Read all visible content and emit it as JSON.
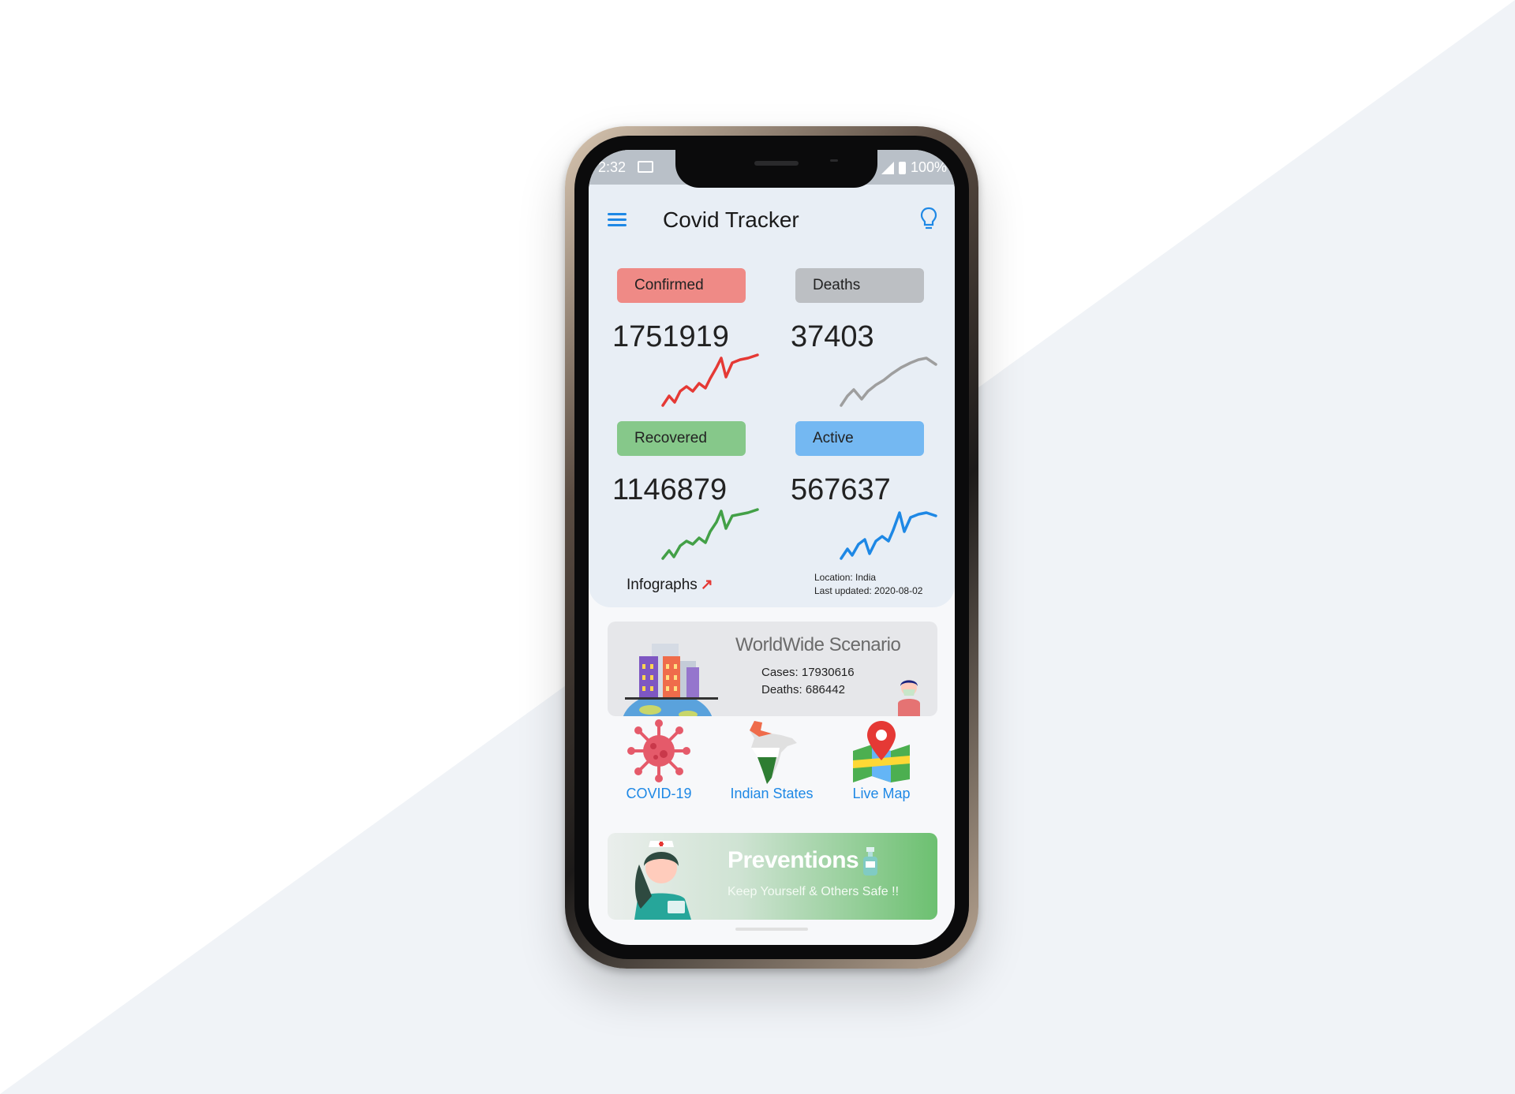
{
  "status_bar": {
    "time": "2:32",
    "battery": "100%"
  },
  "app": {
    "title": "Covid Tracker"
  },
  "stats": [
    {
      "key": "confirmed",
      "label": "Confirmed",
      "value": "1751919",
      "pill_color": "#ef8a86",
      "line_color": "#e53935"
    },
    {
      "key": "deaths",
      "label": "Deaths",
      "value": "37403",
      "pill_color": "#bcbfc3",
      "line_color": "#9e9e9e"
    },
    {
      "key": "recovered",
      "label": "Recovered",
      "value": "1146879",
      "pill_color": "#86c88a",
      "line_color": "#43a047"
    },
    {
      "key": "active",
      "label": "Active",
      "value": "567637",
      "pill_color": "#74b8f2",
      "line_color": "#1e88e5"
    }
  ],
  "infographs_label": "Infographs",
  "meta": {
    "location": "Location: India",
    "updated": "Last updated: 2020-08-02"
  },
  "worldwide": {
    "title": "WorldWide Scenario",
    "cases": "Cases: 17930616",
    "deaths": "Deaths: 686442"
  },
  "shortcuts": [
    {
      "label": "COVID-19",
      "icon": "virus-icon"
    },
    {
      "label": "Indian States",
      "icon": "india-map-icon"
    },
    {
      "label": "Live Map",
      "icon": "map-pin-icon"
    }
  ],
  "preventions": {
    "title": "Preventions",
    "subtitle": "Keep Yourself & Others Safe !!"
  }
}
